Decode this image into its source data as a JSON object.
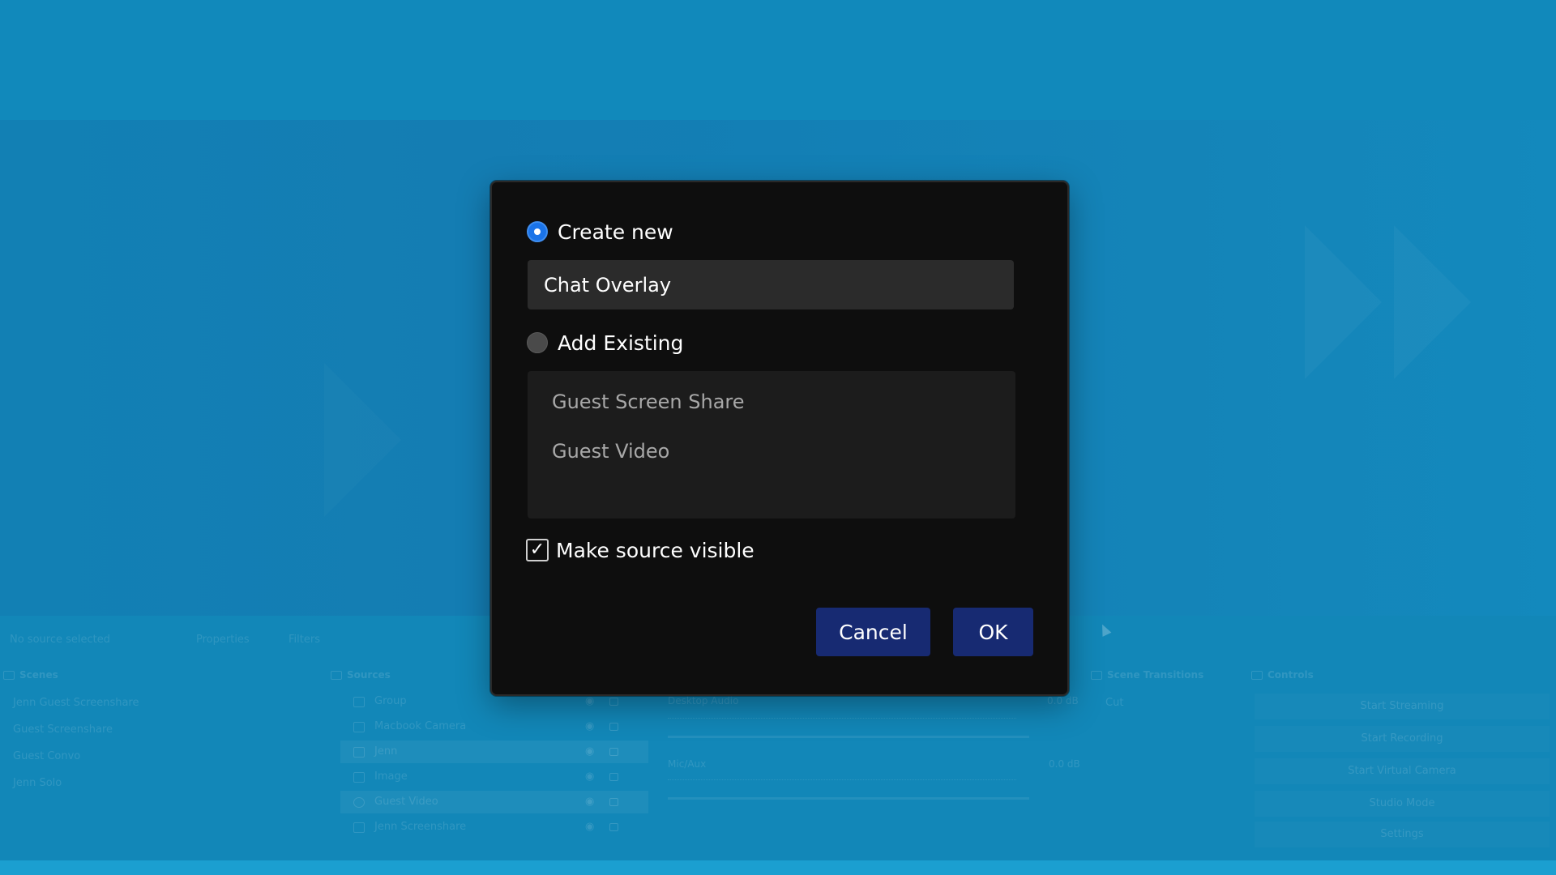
{
  "background": {
    "status": {
      "selection_text": "No source selected",
      "properties_label": "Properties",
      "filters_label": "Filters"
    },
    "docks": {
      "scenes": {
        "title": "Scenes",
        "items": [
          "Jenn Guest Screenshare",
          "Guest Screenshare",
          "Guest Convo",
          "Jenn Solo"
        ]
      },
      "sources": {
        "title": "Sources",
        "items": [
          "Group",
          "Macbook Camera",
          "Jenn",
          "Image",
          "Guest Video",
          "Jenn Screenshare"
        ]
      },
      "mixer": {
        "channels": [
          {
            "name": "Desktop Audio",
            "level": "0.0 dB"
          },
          {
            "name": "Mic/Aux",
            "level": "0.0 dB"
          }
        ]
      },
      "transitions": {
        "title": "Scene Transitions",
        "current": "Cut"
      },
      "controls": {
        "title": "Controls",
        "buttons": [
          "Start Streaming",
          "Start Recording",
          "Start Virtual Camera",
          "Studio Mode",
          "Settings"
        ]
      }
    }
  },
  "dialog": {
    "create_new_label": "Create new",
    "create_new_selected": true,
    "name_value": "Chat Overlay",
    "add_existing_label": "Add Existing",
    "add_existing_selected": false,
    "existing_items": [
      "Guest Screen Share",
      "Guest Video"
    ],
    "make_visible_label": "Make source visible",
    "make_visible_checked": true,
    "cancel_label": "Cancel",
    "ok_label": "OK"
  },
  "colors": {
    "backdrop": "#1287b8",
    "dialog_bg": "#0e0e0e",
    "input_bg": "#2b2b2b",
    "list_bg": "#1c1c1c",
    "button_bg": "#172a72",
    "radio_accent": "#1a73e8"
  },
  "icons": {
    "radio_selected": "radio-on",
    "radio_unselected": "radio-off",
    "checkbox": "check-mark"
  }
}
